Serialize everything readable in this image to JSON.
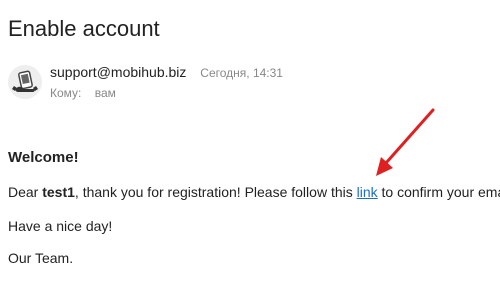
{
  "email": {
    "subject": "Enable account",
    "sender": "support@mobihub.biz",
    "date": "Сегодня, 14:31",
    "to_label": "Кому:",
    "to_value": "вам"
  },
  "body": {
    "greeting": "Welcome!",
    "dear_prefix": "Dear ",
    "username": "test1",
    "dear_middle": ", thank you for registration! Please follow this ",
    "link_text": "link",
    "dear_suffix": " to confirm your email",
    "closing": "Have a nice day!",
    "signature": "Our Team."
  },
  "colors": {
    "link": "#1a6fc9",
    "annotation_arrow": "#e02020",
    "meta_text": "#888888"
  },
  "icons": {
    "avatar": "mobihub-avatar-icon",
    "annotation": "red-arrow-annotation"
  }
}
